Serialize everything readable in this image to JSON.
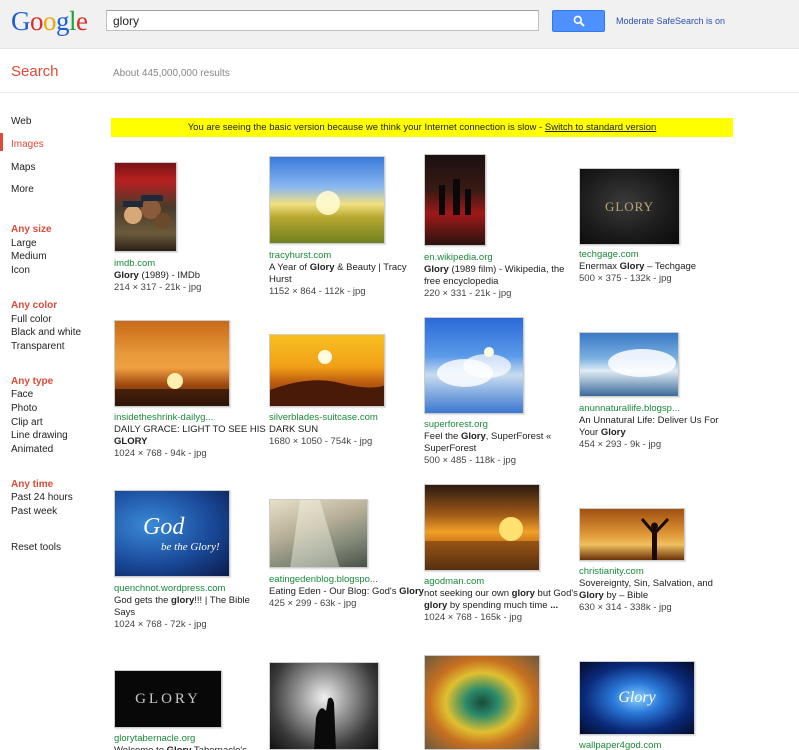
{
  "header": {
    "logo": [
      "G",
      "o",
      "o",
      "g",
      "l",
      "e"
    ],
    "logo_colors": [
      "#1a5fd6",
      "#d8302a",
      "#eda908",
      "#1a5fd6",
      "#23a23a",
      "#d8302a"
    ],
    "query": "glory",
    "safesearch": "Moderate SafeSearch is on"
  },
  "subbar": {
    "title": "Search",
    "count": "About 445,000,000 results"
  },
  "nav": [
    "Web",
    "Images",
    "Maps",
    "More"
  ],
  "filters": {
    "size": {
      "head": "Any size",
      "items": [
        "Large",
        "Medium",
        "Icon"
      ]
    },
    "color": {
      "head": "Any color",
      "items": [
        "Full color",
        "Black and white",
        "Transparent"
      ]
    },
    "type": {
      "head": "Any type",
      "items": [
        "Face",
        "Photo",
        "Clip art",
        "Line drawing",
        "Animated"
      ]
    },
    "time": {
      "head": "Any time",
      "items": [
        "Past 24 hours",
        "Past week"
      ]
    },
    "reset": "Reset tools"
  },
  "notice": {
    "text": "You are seeing the basic version because we think your Internet connection is slow - ",
    "link": "Switch to standard version"
  },
  "results": [
    {
      "site": "imdb.com",
      "title_parts": [
        [
          "b",
          "Glory"
        ],
        [
          "n",
          " (1989) - IMDb"
        ]
      ],
      "dims": "214 × 317 - 21k - jpg"
    },
    {
      "site": "tracyhurst.com",
      "title_parts": [
        [
          "n",
          "A Year of "
        ],
        [
          "b",
          "Glory"
        ],
        [
          "n",
          " & Beauty | Tracy Hurst"
        ]
      ],
      "dims": "1152 × 864 - 112k - jpg"
    },
    {
      "site": "en.wikipedia.org",
      "title_parts": [
        [
          "b",
          "Glory"
        ],
        [
          "n",
          " (1989 film) - Wikipedia, the free encyclopedia"
        ]
      ],
      "dims": "220 × 331 - 21k - jpg"
    },
    {
      "site": "techgage.com",
      "title_parts": [
        [
          "n",
          "Enermax "
        ],
        [
          "b",
          "Glory"
        ],
        [
          "n",
          " – Techgage"
        ]
      ],
      "dims": "500 × 375 - 132k - jpg"
    },
    {
      "site": "insidetheshrink-dailyg...",
      "title_parts": [
        [
          "n",
          "DAILY GRACE: LIGHT TO SEE HIS "
        ],
        [
          "b",
          "GLORY"
        ]
      ],
      "dims": "1024 × 768 - 94k - jpg"
    },
    {
      "site": "silverblades-suitcase.com",
      "title_parts": [
        [
          "n",
          "DARK SUN"
        ]
      ],
      "dims": "1680 × 1050 - 754k - jpg"
    },
    {
      "site": "superforest.org",
      "title_parts": [
        [
          "n",
          "Feel the "
        ],
        [
          "b",
          "Glory"
        ],
        [
          "n",
          ", SuperForest « SuperForest"
        ]
      ],
      "dims": "500 × 485 - 118k - jpg"
    },
    {
      "site": "anunnaturallife.blogsp...",
      "title_parts": [
        [
          "n",
          "An Unnatural Life: Deliver Us For Your "
        ],
        [
          "b",
          "Glory"
        ]
      ],
      "dims": "454 × 293 - 9k - jpg"
    },
    {
      "site": "quenchnot.wordpress.com",
      "title_parts": [
        [
          "n",
          "God gets the "
        ],
        [
          "b",
          "glory"
        ],
        [
          "n",
          "!!! | The Bible Says"
        ]
      ],
      "dims": "1024 × 768 - 72k - jpg"
    },
    {
      "site": "eatingedenblog.blogspo...",
      "title_parts": [
        [
          "n",
          "Eating Eden - Our Blog: God's "
        ],
        [
          "b",
          "Glory"
        ]
      ],
      "dims": "425 × 299 - 63k - jpg"
    },
    {
      "site": "agodman.com",
      "title_parts": [
        [
          "n",
          "not seeking our own "
        ],
        [
          "b",
          "glory"
        ],
        [
          "n",
          " but God's "
        ],
        [
          "b",
          "glory"
        ],
        [
          "n",
          " by spending much time "
        ],
        [
          "b",
          "..."
        ]
      ],
      "dims": "1024 × 768 - 165k - jpg"
    },
    {
      "site": "christianity.com",
      "title_parts": [
        [
          "n",
          "Sovereignty, Sin, Salvation, and "
        ],
        [
          "b",
          "Glory"
        ],
        [
          "n",
          " by – Bible"
        ]
      ],
      "dims": "630 × 314 - 338k - jpg"
    },
    {
      "site": "glorytabernacle.org",
      "title_parts": [
        [
          "n",
          "Welcome to "
        ],
        [
          "b",
          "Glory"
        ],
        [
          "n",
          " Tabernacle's"
        ]
      ],
      "dims": ""
    },
    {
      "site": "",
      "title_parts": [],
      "dims": ""
    },
    {
      "site": "",
      "title_parts": [],
      "dims": ""
    },
    {
      "site": "wallpaper4god.com",
      "title_parts": [],
      "dims": ""
    }
  ],
  "thumb_text": {
    "techgage": "GLORY",
    "god_a": "God",
    "god_b": "be the Glory!",
    "glory_tab": "GLORY",
    "wall": "Glory"
  }
}
